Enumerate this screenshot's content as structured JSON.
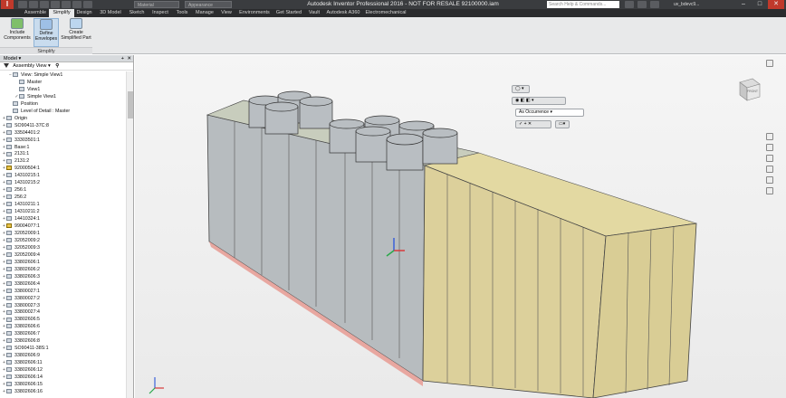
{
  "titlebar": {
    "app_letter": "I",
    "title": "Autodesk Inventor Professional 2016 - NOT FOR RESALE   92100000.iam",
    "material_combo": "Material",
    "appearance_combo": "Appearance",
    "search_placeholder": "Search Help & Commands...",
    "user": "uv_bdevc9..."
  },
  "tabs": [
    "Assemble",
    "Simplify",
    "Design",
    "3D Model",
    "Sketch",
    "Inspect",
    "Tools",
    "Manage",
    "View",
    "Environments",
    "Get Started",
    "Vault",
    "Autodesk A360",
    "Electromechanical"
  ],
  "active_tab": "Simplify",
  "ribbon": {
    "buttons": [
      {
        "line1": "Include",
        "line2": "Components"
      },
      {
        "line1": "Define",
        "line2": "Envelopes"
      },
      {
        "line1": "Create",
        "line2": "Simplified Part"
      }
    ],
    "panel_label": "Simplify"
  },
  "browser": {
    "title": "Model",
    "view_label": "Assembly View",
    "tree": [
      {
        "label": "View: Simple View1",
        "indent": 2,
        "exp": "−"
      },
      {
        "label": "Master",
        "indent": 3,
        "exp": ""
      },
      {
        "label": "View1",
        "indent": 3,
        "exp": ""
      },
      {
        "label": "Simple View1",
        "indent": 3,
        "exp": "✓"
      },
      {
        "label": "Position",
        "indent": 2,
        "exp": ""
      },
      {
        "label": "Level of Detail : Master",
        "indent": 2,
        "exp": ""
      },
      {
        "label": "Origin",
        "indent": 1,
        "exp": "+"
      },
      {
        "label": "SO90411-37C:8",
        "indent": 1,
        "exp": "+"
      },
      {
        "label": "33504401:2",
        "indent": 1,
        "exp": "+"
      },
      {
        "label": "33303501:1",
        "indent": 1,
        "exp": "+"
      },
      {
        "label": "Base:1",
        "indent": 1,
        "exp": "+"
      },
      {
        "label": "2131:1",
        "indent": 1,
        "exp": "+"
      },
      {
        "label": "2131:2",
        "indent": 1,
        "exp": "+"
      },
      {
        "label": "92000504:1",
        "indent": 1,
        "exp": "+",
        "yellow": true
      },
      {
        "label": "14310215:1",
        "indent": 1,
        "exp": "+"
      },
      {
        "label": "14310215:2",
        "indent": 1,
        "exp": "+"
      },
      {
        "label": "256:1",
        "indent": 1,
        "exp": "+"
      },
      {
        "label": "256:2",
        "indent": 1,
        "exp": "+"
      },
      {
        "label": "14310211:1",
        "indent": 1,
        "exp": "+"
      },
      {
        "label": "14310211:2",
        "indent": 1,
        "exp": "+"
      },
      {
        "label": "14410324:1",
        "indent": 1,
        "exp": "+"
      },
      {
        "label": "99004077:1",
        "indent": 1,
        "exp": "+",
        "yellow": true
      },
      {
        "label": "32052009:1",
        "indent": 1,
        "exp": "+"
      },
      {
        "label": "32052009:2",
        "indent": 1,
        "exp": "+"
      },
      {
        "label": "32052009:3",
        "indent": 1,
        "exp": "+"
      },
      {
        "label": "32052009:4",
        "indent": 1,
        "exp": "+"
      },
      {
        "label": "33802606:1",
        "indent": 1,
        "exp": "+"
      },
      {
        "label": "33802606:2",
        "indent": 1,
        "exp": "+"
      },
      {
        "label": "33802606:3",
        "indent": 1,
        "exp": "+"
      },
      {
        "label": "33802606:4",
        "indent": 1,
        "exp": "+"
      },
      {
        "label": "33800027:1",
        "indent": 1,
        "exp": "+"
      },
      {
        "label": "33800027:2",
        "indent": 1,
        "exp": "+"
      },
      {
        "label": "33800027:3",
        "indent": 1,
        "exp": "+"
      },
      {
        "label": "33800027:4",
        "indent": 1,
        "exp": "+"
      },
      {
        "label": "33802606:5",
        "indent": 1,
        "exp": "+"
      },
      {
        "label": "33802606:6",
        "indent": 1,
        "exp": "+"
      },
      {
        "label": "33802606:7",
        "indent": 1,
        "exp": "+"
      },
      {
        "label": "33802606:8",
        "indent": 1,
        "exp": "+"
      },
      {
        "label": "SO90411-38S:1",
        "indent": 1,
        "exp": "+"
      },
      {
        "label": "33802606:9",
        "indent": 1,
        "exp": "+"
      },
      {
        "label": "33802606:11",
        "indent": 1,
        "exp": "+"
      },
      {
        "label": "33802606:12",
        "indent": 1,
        "exp": "+"
      },
      {
        "label": "33802606:14",
        "indent": 1,
        "exp": "+"
      },
      {
        "label": "33802606:15",
        "indent": 1,
        "exp": "+"
      },
      {
        "label": "33802606:16",
        "indent": 1,
        "exp": "+"
      }
    ]
  },
  "viewport": {
    "occurrence_dropdown": "As Occurrence",
    "viewcube_label": "FRONT"
  },
  "colors": {
    "panel_tan": "#e3d9a2",
    "glass": "#b7bcbf",
    "cylinder": "#b9bec2",
    "base_red": "#e8a7a0"
  }
}
